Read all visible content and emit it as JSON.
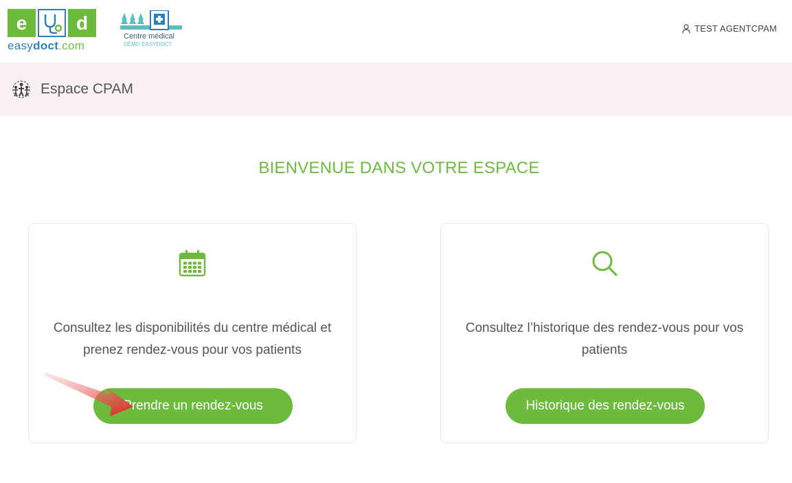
{
  "header": {
    "logo": {
      "tiles": [
        "e",
        "",
        "d"
      ],
      "text_brand": "easy",
      "text_bold": "doct",
      "text_tld": ".com"
    },
    "centre": {
      "name": "Centre médical",
      "sub": "DÉMO EASYDOCT"
    },
    "user": {
      "icon": "user-icon",
      "label": "TEST AGENTCPAM"
    }
  },
  "subbar": {
    "icon": "people-group-icon",
    "title": "Espace CPAM"
  },
  "main": {
    "welcome": "BIENVENUE DANS VOTRE ESPACE",
    "cards": [
      {
        "icon": "calendar-icon",
        "text": "Consultez les disponibilités du centre médical et prenez rendez-vous pour vos patients",
        "button": "Prendre un rendez-vous"
      },
      {
        "icon": "search-icon",
        "text": "Consultez l’historique des rendez-vous pour vos patients",
        "button": "Historique des rendez-vous"
      }
    ]
  },
  "colors": {
    "accent": "#6cbb3c",
    "brand_blue": "#2f7fb8",
    "subbar_bg": "#f8f0f1",
    "annotation_arrow": "#e02020"
  }
}
